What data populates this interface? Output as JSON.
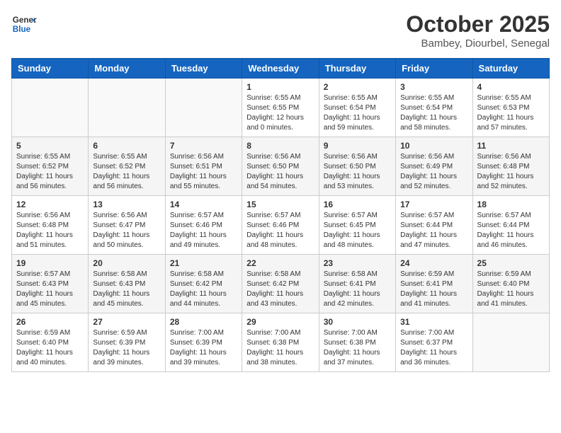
{
  "header": {
    "logo_general": "General",
    "logo_blue": "Blue",
    "month_title": "October 2025",
    "location": "Bambey, Diourbel, Senegal"
  },
  "days_of_week": [
    "Sunday",
    "Monday",
    "Tuesday",
    "Wednesday",
    "Thursday",
    "Friday",
    "Saturday"
  ],
  "weeks": [
    [
      {
        "day": "",
        "info": ""
      },
      {
        "day": "",
        "info": ""
      },
      {
        "day": "",
        "info": ""
      },
      {
        "day": "1",
        "info": "Sunrise: 6:55 AM\nSunset: 6:55 PM\nDaylight: 12 hours\nand 0 minutes."
      },
      {
        "day": "2",
        "info": "Sunrise: 6:55 AM\nSunset: 6:54 PM\nDaylight: 11 hours\nand 59 minutes."
      },
      {
        "day": "3",
        "info": "Sunrise: 6:55 AM\nSunset: 6:54 PM\nDaylight: 11 hours\nand 58 minutes."
      },
      {
        "day": "4",
        "info": "Sunrise: 6:55 AM\nSunset: 6:53 PM\nDaylight: 11 hours\nand 57 minutes."
      }
    ],
    [
      {
        "day": "5",
        "info": "Sunrise: 6:55 AM\nSunset: 6:52 PM\nDaylight: 11 hours\nand 56 minutes."
      },
      {
        "day": "6",
        "info": "Sunrise: 6:55 AM\nSunset: 6:52 PM\nDaylight: 11 hours\nand 56 minutes."
      },
      {
        "day": "7",
        "info": "Sunrise: 6:56 AM\nSunset: 6:51 PM\nDaylight: 11 hours\nand 55 minutes."
      },
      {
        "day": "8",
        "info": "Sunrise: 6:56 AM\nSunset: 6:50 PM\nDaylight: 11 hours\nand 54 minutes."
      },
      {
        "day": "9",
        "info": "Sunrise: 6:56 AM\nSunset: 6:50 PM\nDaylight: 11 hours\nand 53 minutes."
      },
      {
        "day": "10",
        "info": "Sunrise: 6:56 AM\nSunset: 6:49 PM\nDaylight: 11 hours\nand 52 minutes."
      },
      {
        "day": "11",
        "info": "Sunrise: 6:56 AM\nSunset: 6:48 PM\nDaylight: 11 hours\nand 52 minutes."
      }
    ],
    [
      {
        "day": "12",
        "info": "Sunrise: 6:56 AM\nSunset: 6:48 PM\nDaylight: 11 hours\nand 51 minutes."
      },
      {
        "day": "13",
        "info": "Sunrise: 6:56 AM\nSunset: 6:47 PM\nDaylight: 11 hours\nand 50 minutes."
      },
      {
        "day": "14",
        "info": "Sunrise: 6:57 AM\nSunset: 6:46 PM\nDaylight: 11 hours\nand 49 minutes."
      },
      {
        "day": "15",
        "info": "Sunrise: 6:57 AM\nSunset: 6:46 PM\nDaylight: 11 hours\nand 48 minutes."
      },
      {
        "day": "16",
        "info": "Sunrise: 6:57 AM\nSunset: 6:45 PM\nDaylight: 11 hours\nand 48 minutes."
      },
      {
        "day": "17",
        "info": "Sunrise: 6:57 AM\nSunset: 6:44 PM\nDaylight: 11 hours\nand 47 minutes."
      },
      {
        "day": "18",
        "info": "Sunrise: 6:57 AM\nSunset: 6:44 PM\nDaylight: 11 hours\nand 46 minutes."
      }
    ],
    [
      {
        "day": "19",
        "info": "Sunrise: 6:57 AM\nSunset: 6:43 PM\nDaylight: 11 hours\nand 45 minutes."
      },
      {
        "day": "20",
        "info": "Sunrise: 6:58 AM\nSunset: 6:43 PM\nDaylight: 11 hours\nand 45 minutes."
      },
      {
        "day": "21",
        "info": "Sunrise: 6:58 AM\nSunset: 6:42 PM\nDaylight: 11 hours\nand 44 minutes."
      },
      {
        "day": "22",
        "info": "Sunrise: 6:58 AM\nSunset: 6:42 PM\nDaylight: 11 hours\nand 43 minutes."
      },
      {
        "day": "23",
        "info": "Sunrise: 6:58 AM\nSunset: 6:41 PM\nDaylight: 11 hours\nand 42 minutes."
      },
      {
        "day": "24",
        "info": "Sunrise: 6:59 AM\nSunset: 6:41 PM\nDaylight: 11 hours\nand 41 minutes."
      },
      {
        "day": "25",
        "info": "Sunrise: 6:59 AM\nSunset: 6:40 PM\nDaylight: 11 hours\nand 41 minutes."
      }
    ],
    [
      {
        "day": "26",
        "info": "Sunrise: 6:59 AM\nSunset: 6:40 PM\nDaylight: 11 hours\nand 40 minutes."
      },
      {
        "day": "27",
        "info": "Sunrise: 6:59 AM\nSunset: 6:39 PM\nDaylight: 11 hours\nand 39 minutes."
      },
      {
        "day": "28",
        "info": "Sunrise: 7:00 AM\nSunset: 6:39 PM\nDaylight: 11 hours\nand 39 minutes."
      },
      {
        "day": "29",
        "info": "Sunrise: 7:00 AM\nSunset: 6:38 PM\nDaylight: 11 hours\nand 38 minutes."
      },
      {
        "day": "30",
        "info": "Sunrise: 7:00 AM\nSunset: 6:38 PM\nDaylight: 11 hours\nand 37 minutes."
      },
      {
        "day": "31",
        "info": "Sunrise: 7:00 AM\nSunset: 6:37 PM\nDaylight: 11 hours\nand 36 minutes."
      },
      {
        "day": "",
        "info": ""
      }
    ]
  ]
}
